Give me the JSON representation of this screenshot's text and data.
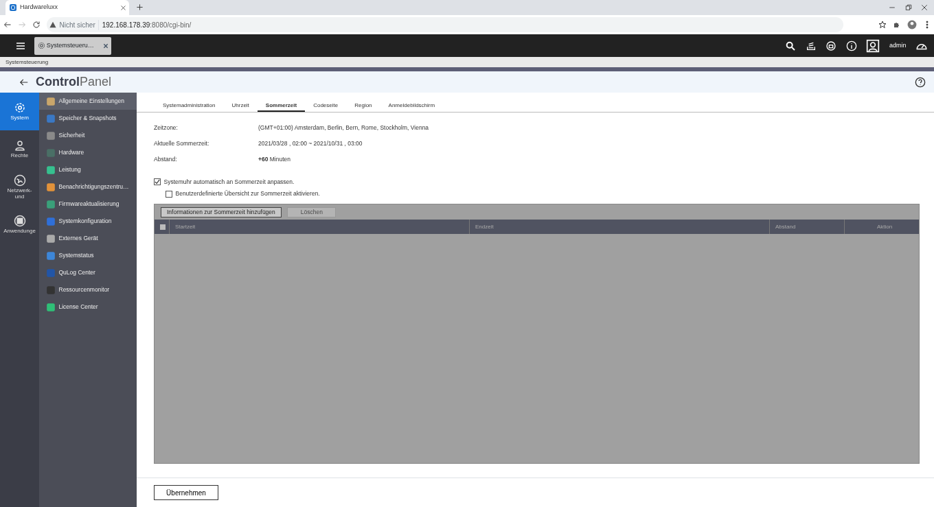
{
  "browser": {
    "tab_title": "Hardwareluxx",
    "security_label": "Nicht sicher",
    "url_host": "192.168.178.39",
    "url_rest": ":8080/cgi-bin/"
  },
  "topbar": {
    "app_tab": "Systemsteueru…",
    "user": "admin"
  },
  "window": {
    "title": "Systemsteuerung"
  },
  "header": {
    "title_bold": "Control",
    "title_light": "Panel"
  },
  "rail": [
    {
      "label": "System",
      "selected": true
    },
    {
      "label": "Rechte",
      "selected": false
    },
    {
      "label": "Netzwerk-\nund",
      "selected": false
    },
    {
      "label": "Anwendunge",
      "selected": false
    }
  ],
  "menu": [
    {
      "label": "Allgemeine Einstellungen",
      "selected": true
    },
    {
      "label": "Speicher & Snapshots",
      "selected": false
    },
    {
      "label": "Sicherheit",
      "selected": false
    },
    {
      "label": "Hardware",
      "selected": false
    },
    {
      "label": "Leistung",
      "selected": false
    },
    {
      "label": "Benachrichtigungszentru…",
      "selected": false
    },
    {
      "label": "Firmwareaktualisierung",
      "selected": false
    },
    {
      "label": "Systemkonfiguration",
      "selected": false
    },
    {
      "label": "Externes Gerät",
      "selected": false
    },
    {
      "label": "Systemstatus",
      "selected": false
    },
    {
      "label": "QuLog Center",
      "selected": false
    },
    {
      "label": "Ressourcenmonitor",
      "selected": false
    },
    {
      "label": "License Center",
      "selected": false
    }
  ],
  "tabs": [
    {
      "label": "Systemadministration",
      "selected": false
    },
    {
      "label": "Uhrzeit",
      "selected": false
    },
    {
      "label": "Sommerzeit",
      "selected": true
    },
    {
      "label": "Codeseite",
      "selected": false
    },
    {
      "label": "Region",
      "selected": false
    },
    {
      "label": "Anmeldebildschirm",
      "selected": false
    }
  ],
  "info": [
    {
      "label": "Zeitzone:",
      "value": "(GMT+01:00) Amsterdam, Berlin, Bern, Rome, Stockholm, Vienna"
    },
    {
      "label": "Aktuelle Sommerzeit:",
      "value": "2021/03/28 , 02:00 ~ 2021/10/31 , 03:00"
    },
    {
      "label": "Abstand:",
      "value": "**+60** Minuten"
    }
  ],
  "options": [
    {
      "label": "Systemuhr automatisch an Sommerzeit anpassen.",
      "checked": true
    },
    {
      "label": "Benutzerdefinierte Übersicht zur Sommerzeit aktivieren.",
      "checked": false
    }
  ],
  "table": {
    "buttons": [
      {
        "label": "Informationen zur Sommerzeit hinzufügen",
        "disabled": false
      },
      {
        "label": "Löschen",
        "disabled": true
      }
    ],
    "select_all": {
      "checked": false
    },
    "columns": [
      "Startzeit",
      "Endzeit",
      "Abstand",
      "Aktion"
    ]
  },
  "apply_button": "Übernehmen"
}
